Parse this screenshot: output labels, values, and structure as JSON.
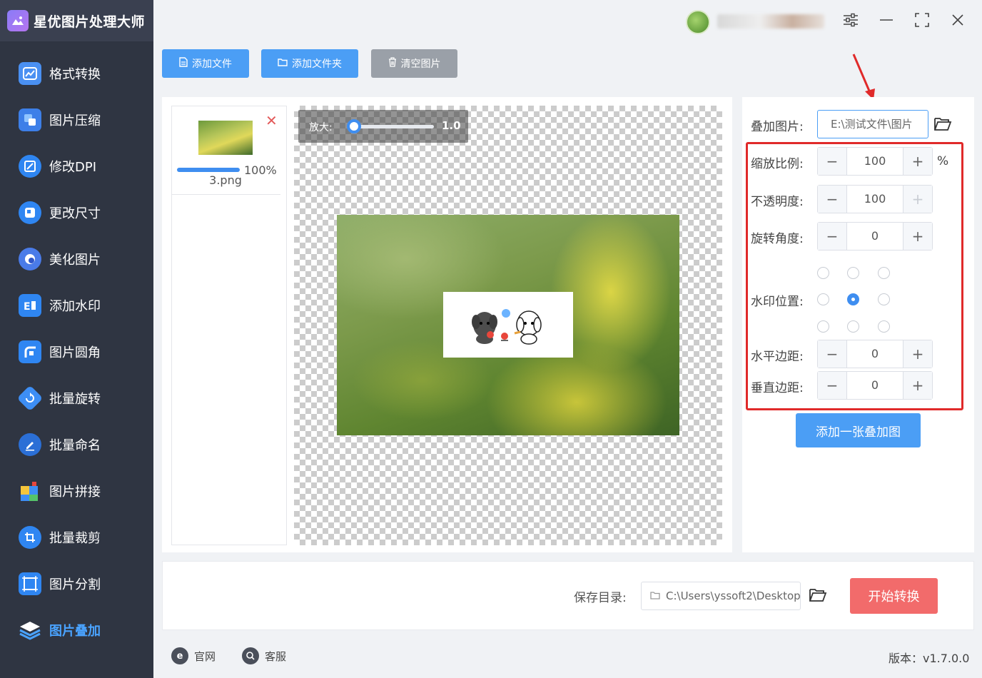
{
  "app": {
    "title": "星优图片处理大师"
  },
  "sidebar": {
    "items": [
      {
        "label": "格式转换",
        "icon": "format-convert-icon",
        "color": "#4a90f2"
      },
      {
        "label": "图片压缩",
        "icon": "compress-icon",
        "color": "#3d7fe8"
      },
      {
        "label": "修改DPI",
        "icon": "dpi-icon",
        "color": "#2f86f2"
      },
      {
        "label": "更改尺寸",
        "icon": "resize-icon",
        "color": "#2f86f2"
      },
      {
        "label": "美化图片",
        "icon": "beautify-icon",
        "color": "#4a7be8"
      },
      {
        "label": "添加水印",
        "icon": "watermark-icon",
        "color": "#2f86f2"
      },
      {
        "label": "图片圆角",
        "icon": "round-corner-icon",
        "color": "#2f86f2"
      },
      {
        "label": "批量旋转",
        "icon": "rotate-icon",
        "color": "#3d8ef5"
      },
      {
        "label": "批量命名",
        "icon": "rename-icon",
        "color": "#2b6fd6"
      },
      {
        "label": "图片拼接",
        "icon": "puzzle-icon",
        "color": "#3d8ef5"
      },
      {
        "label": "批量裁剪",
        "icon": "crop-icon",
        "color": "#2f86f2"
      },
      {
        "label": "图片分割",
        "icon": "split-icon",
        "color": "#2f86f2"
      },
      {
        "label": "图片叠加",
        "icon": "layers-icon",
        "color": "#4aa3ff"
      }
    ]
  },
  "toolbar": {
    "add_file": "添加文件",
    "add_folder": "添加文件夹",
    "clear": "清空图片"
  },
  "file_list": {
    "items": [
      {
        "name": "3.png",
        "progress_text": "100%",
        "progress": 1.0
      }
    ]
  },
  "preview": {
    "zoom_label": "放大:",
    "zoom_value": "1.0"
  },
  "settings": {
    "overlay_label": "叠加图片:",
    "overlay_path": "E:\\测试文件\\图片",
    "scale_label": "缩放比例:",
    "scale_value": "100",
    "scale_unit": "%",
    "opacity_label": "不透明度:",
    "opacity_value": "100",
    "rotate_label": "旋转角度:",
    "rotate_value": "0",
    "position_label": "水印位置:",
    "position_selected": "center",
    "h_margin_label": "水平边距:",
    "h_margin_value": "0",
    "v_margin_label": "垂直边距:",
    "v_margin_value": "0",
    "add_overlay_button": "添加一张叠加图"
  },
  "bottom": {
    "save_label": "保存目录:",
    "save_path": "C:\\Users\\yssoft2\\Desktop",
    "start_button": "开始转换"
  },
  "footer": {
    "website": "官网",
    "support": "客服",
    "version": "版本：v1.7.0.0"
  },
  "colors": {
    "accent": "#4b9ef5",
    "start": "#f26b6b",
    "sidebar_bg": "#2f3542",
    "highlight": "#e02a2a"
  }
}
